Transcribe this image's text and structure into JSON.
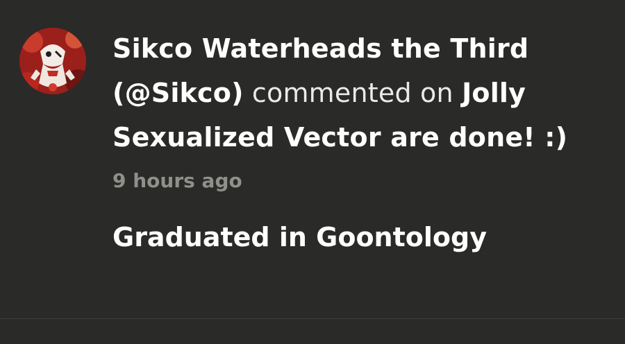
{
  "notification": {
    "actor_name": "Sikco Waterheads the Third",
    "actor_handle": "(@Sikco)",
    "action_text": "commented on",
    "post_title": "Jolly Sexualized Vector are done! :)",
    "timestamp": "9 hours ago",
    "comment_text": "Graduated in Goontology",
    "avatar_icon": "character-avatar"
  },
  "colors": {
    "background": "#2a2a28",
    "text_primary": "#ffffff",
    "text_muted": "#8f8f8b",
    "avatar_accent": "#c22a22"
  }
}
